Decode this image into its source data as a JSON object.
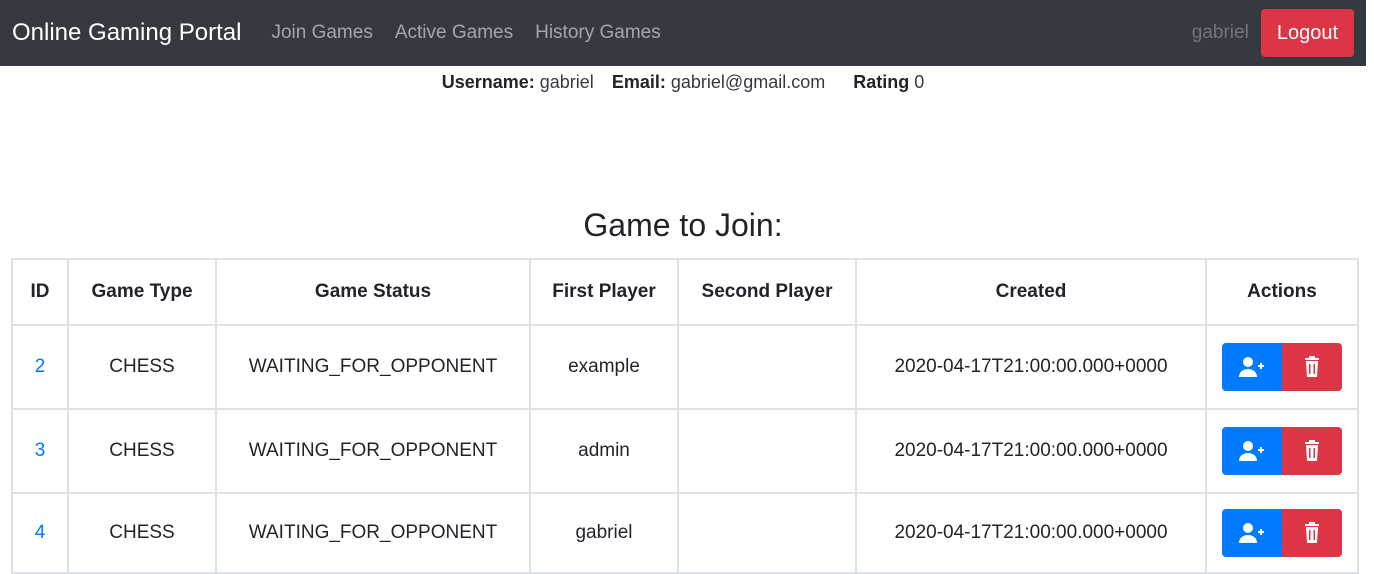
{
  "navbar": {
    "brand": "Online Gaming Portal",
    "links": [
      "Join Games",
      "Active Games",
      "History Games"
    ],
    "user": "gabriel",
    "logout_label": "Logout"
  },
  "profile": {
    "username_label": "Username:",
    "username": "gabriel",
    "email_label": "Email:",
    "email": "gabriel@gmail.com",
    "rating_label": "Rating",
    "rating": "0"
  },
  "main": {
    "heading": "Game to Join:",
    "table": {
      "columns": [
        "ID",
        "Game Type",
        "Game Status",
        "First Player",
        "Second Player",
        "Created",
        "Actions"
      ],
      "rows": [
        {
          "id": "2",
          "type": "CHESS",
          "status": "WAITING_FOR_OPPONENT",
          "first": "example",
          "second": "",
          "created": "2020-04-17T21:00:00.000+0000"
        },
        {
          "id": "3",
          "type": "CHESS",
          "status": "WAITING_FOR_OPPONENT",
          "first": "admin",
          "second": "",
          "created": "2020-04-17T21:00:00.000+0000"
        },
        {
          "id": "4",
          "type": "CHESS",
          "status": "WAITING_FOR_OPPONENT",
          "first": "gabriel",
          "second": "",
          "created": "2020-04-17T21:00:00.000+0000"
        }
      ]
    }
  },
  "icons": {
    "join": "user-plus-icon",
    "delete": "trash-icon"
  },
  "colors": {
    "navbar": "#343a40",
    "primary": "#007bff",
    "danger": "#dc3545"
  }
}
